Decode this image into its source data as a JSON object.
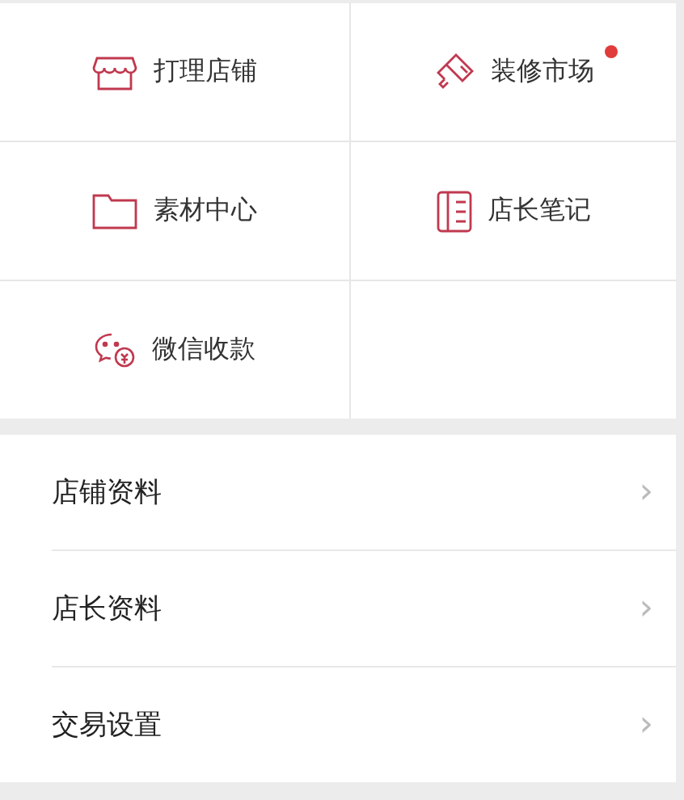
{
  "tiles": [
    {
      "label": "打理店铺",
      "badge": false
    },
    {
      "label": "装修市场",
      "badge": true
    },
    {
      "label": "素材中心",
      "badge": false
    },
    {
      "label": "店长笔记",
      "badge": false
    },
    {
      "label": "微信收款",
      "badge": false
    }
  ],
  "menu": [
    {
      "label": "店铺资料",
      "chevron": "›"
    },
    {
      "label": "店长资料",
      "chevron": "›"
    },
    {
      "label": "交易设置",
      "chevron": "›"
    }
  ]
}
